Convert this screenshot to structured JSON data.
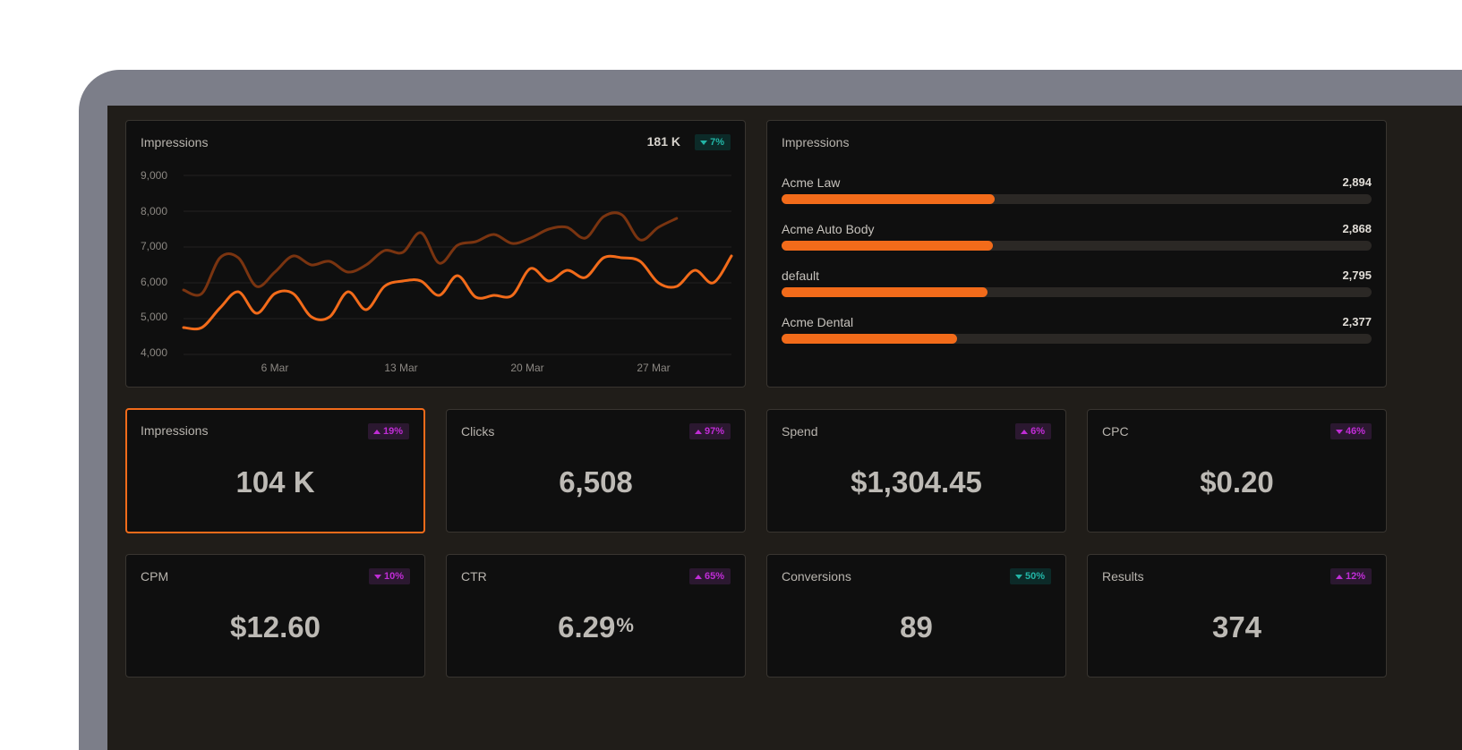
{
  "line_card": {
    "title": "Impressions",
    "total": "181 K",
    "badge": {
      "text": "7%",
      "direction": "down",
      "color": "#22b5a6"
    }
  },
  "chart_data": {
    "type": "line",
    "ylim": [
      4000,
      9000
    ],
    "yticks": [
      "9,000",
      "8,000",
      "7,000",
      "6,000",
      "5,000",
      "4,000"
    ],
    "x_ticks": [
      "6 Mar",
      "13 Mar",
      "20 Mar",
      "27 Mar"
    ],
    "grid": true,
    "series": [
      {
        "role": "previous period",
        "color": "#7a3410",
        "values": [
          5800,
          5700,
          6700,
          6700,
          5900,
          6300,
          6750,
          6500,
          6600,
          6300,
          6500,
          6900,
          6850,
          7400,
          6550,
          7050,
          7150,
          7350,
          7100,
          7250,
          7500,
          7550,
          7250,
          7850,
          7900,
          7200,
          7550,
          7800
        ]
      },
      {
        "role": "current period",
        "color": "#f26b1a",
        "values": [
          4750,
          4750,
          5300,
          5750,
          5150,
          5700,
          5700,
          5050,
          5050,
          5750,
          5250,
          5900,
          6050,
          6050,
          5650,
          6200,
          5600,
          5650,
          5650,
          6400,
          6050,
          6350,
          6150,
          6700,
          6700,
          6600,
          6000,
          5900,
          6350,
          6000,
          6750
        ]
      }
    ]
  },
  "bars_card": {
    "title": "Impressions",
    "max_value": 8000,
    "rows": [
      {
        "label": "Acme Law",
        "value_text": "2,894",
        "value": 2894
      },
      {
        "label": "Acme Auto Body",
        "value_text": "2,868",
        "value": 2868
      },
      {
        "label": "default",
        "value_text": "2,795",
        "value": 2795
      },
      {
        "label": "Acme Dental",
        "value_text": "2,377",
        "value": 2377
      }
    ]
  },
  "kpis": [
    {
      "title": "Impressions",
      "value": "104 K",
      "suffix": "",
      "badge": "19%",
      "direction": "up",
      "tone": "purple"
    },
    {
      "title": "Clicks",
      "value": "6,508",
      "suffix": "",
      "badge": "97%",
      "direction": "up",
      "tone": "purple"
    },
    {
      "title": "Spend",
      "value": "$1,304.45",
      "suffix": "",
      "badge": "6%",
      "direction": "up",
      "tone": "purple"
    },
    {
      "title": "CPC",
      "value": "$0.20",
      "suffix": "",
      "badge": "46%",
      "direction": "down",
      "tone": "purple"
    },
    {
      "title": "CPM",
      "value": "$12.60",
      "suffix": "",
      "badge": "10%",
      "direction": "down",
      "tone": "purple"
    },
    {
      "title": "CTR",
      "value": "6.29",
      "suffix": "%",
      "badge": "65%",
      "direction": "up",
      "tone": "purple"
    },
    {
      "title": "Conversions",
      "value": "89",
      "suffix": "",
      "badge": "50%",
      "direction": "down",
      "tone": "teal"
    },
    {
      "title": "Results",
      "value": "374",
      "suffix": "",
      "badge": "12%",
      "direction": "up",
      "tone": "purple"
    }
  ],
  "colors": {
    "accent": "#f26b1a",
    "up_purple": "#c02cd6",
    "down_teal": "#22b5a6"
  }
}
